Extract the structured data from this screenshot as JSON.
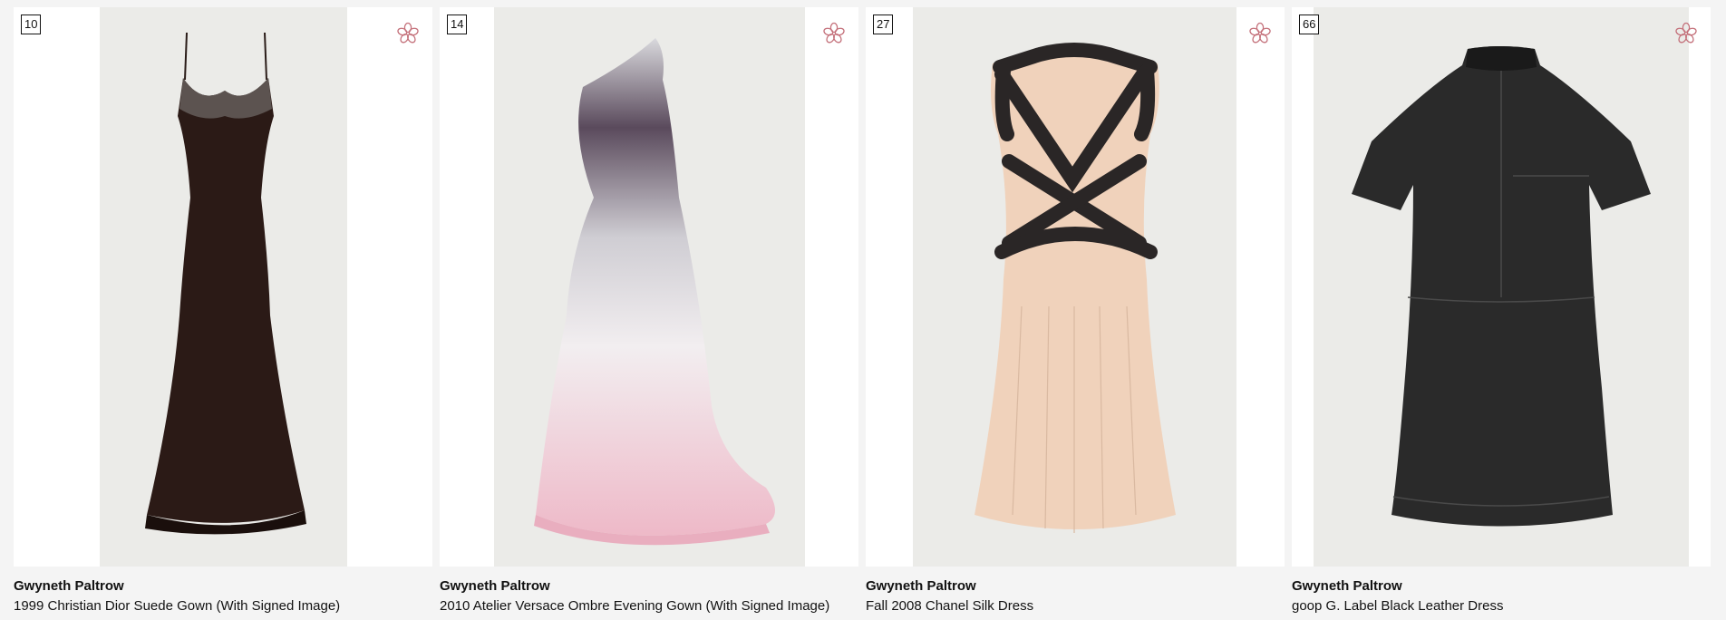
{
  "lots": [
    {
      "lot_number": "10",
      "artist": "Gwyneth Paltrow",
      "title": "1999 Christian Dior Suede Gown (With Signed Image)",
      "image_icon": "black-lace-gown-image"
    },
    {
      "lot_number": "14",
      "artist": "Gwyneth Paltrow",
      "title": "2010 Atelier Versace Ombre Evening Gown (With Signed Image)",
      "image_icon": "ombre-one-shoulder-gown-image"
    },
    {
      "lot_number": "27",
      "artist": "Gwyneth Paltrow",
      "title": "Fall 2008 Chanel Silk Dress",
      "image_icon": "beige-strap-dress-image"
    },
    {
      "lot_number": "66",
      "artist": "Gwyneth Paltrow",
      "title": "goop G. Label Black Leather Dress",
      "image_icon": "black-leather-dress-image"
    }
  ],
  "favorite_icon": "flower-outline-icon",
  "colors": {
    "favorite_icon": "#c4707a",
    "photo_background": "#ebebe8"
  }
}
